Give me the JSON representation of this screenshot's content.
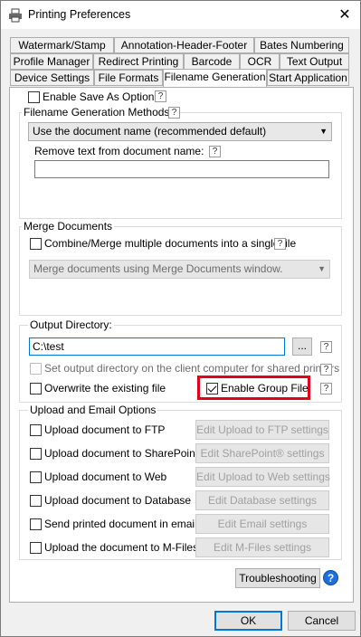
{
  "window": {
    "title": "Printing Preferences",
    "close_glyph": "✕"
  },
  "tabs": {
    "row1": [
      "Watermark/Stamp",
      "Annotation-Header-Footer",
      "Bates Numbering"
    ],
    "row2": [
      "Profile Manager",
      "Redirect Printing",
      "Barcode",
      "OCR",
      "Text Output"
    ],
    "row3": [
      "Device Settings",
      "File Formats",
      "Filename Generation",
      "Start Application"
    ],
    "active": "Filename Generation"
  },
  "save_as": {
    "label": "Enable Save As Option",
    "checked": false
  },
  "filename_methods": {
    "legend": "Filename Generation Methods",
    "method_value": "Use the document name (recommended default)",
    "remove_text_label": "Remove text from document name:",
    "remove_text_value": ""
  },
  "merge": {
    "legend": "Merge Documents",
    "combine_label": "Combine/Merge multiple documents into a single file",
    "combine_checked": false,
    "merge_method_value": "Merge documents using Merge Documents window."
  },
  "output": {
    "legend": "Output Directory:",
    "directory_value": "C:\\test",
    "browse_label": "...",
    "client_dir_label": "Set output directory on the client computer for shared printers",
    "overwrite_label": "Overwrite the existing file",
    "overwrite_checked": false,
    "group_file_label": "Enable Group File",
    "group_file_checked": true
  },
  "upload": {
    "legend": "Upload and Email Options",
    "items": [
      {
        "label": "Upload document to FTP",
        "button": "Edit Upload to FTP settings"
      },
      {
        "label": "Upload document to SharePoint®",
        "button": "Edit SharePoint® settings"
      },
      {
        "label": "Upload document to Web",
        "button": "Edit Upload to Web settings"
      },
      {
        "label": "Upload document to Database",
        "button": "Edit Database settings"
      },
      {
        "label": "Send printed document in email",
        "button": "Edit Email settings"
      },
      {
        "label": "Upload the document to M-Files",
        "button": "Edit M-Files settings"
      }
    ]
  },
  "troubleshooting_label": "Troubleshooting",
  "help_glyph": "?",
  "info_glyph": "?",
  "ok_label": "OK",
  "cancel_label": "Cancel",
  "colors": {
    "highlight": "#e3001b",
    "focus": "#0078d7"
  }
}
